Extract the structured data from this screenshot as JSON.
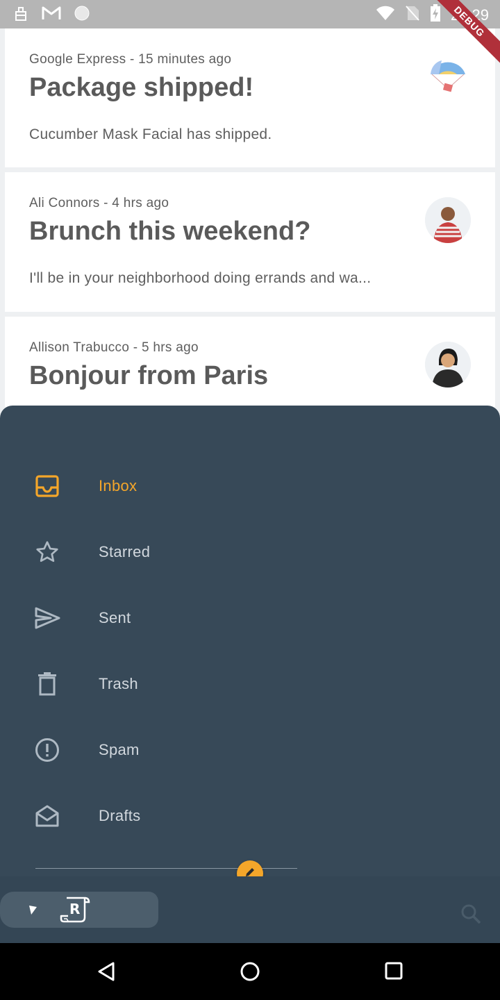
{
  "status_bar": {
    "time": "23:29",
    "debug_label": "DEBUG",
    "icons": [
      "notification-icon",
      "gmail-icon",
      "circle-icon",
      "wifi-icon",
      "no-sim-icon",
      "battery-charging-icon"
    ]
  },
  "emails": [
    {
      "sender": "Google Express",
      "time": "15 minutes ago",
      "meta": "Google Express - 15 minutes ago",
      "subject": "Package shipped!",
      "preview": "Cucumber Mask Facial has shipped.",
      "avatar": "parachute-avatar"
    },
    {
      "sender": "Ali Connors",
      "time": "4 hrs ago",
      "meta": "Ali Connors - 4 hrs ago",
      "subject": "Brunch this weekend?",
      "preview": "I'll be in your neighborhood doing errands and wa...",
      "avatar": "ali-connors-avatar"
    },
    {
      "sender": "Allison Trabucco",
      "time": "5 hrs ago",
      "meta": "Allison Trabucco - 5 hrs ago",
      "subject": "Bonjour from Paris",
      "preview": "",
      "avatar": "allison-trabucco-avatar"
    }
  ],
  "drawer": {
    "items": [
      {
        "label": "Inbox",
        "icon": "inbox-icon",
        "active": true
      },
      {
        "label": "Starred",
        "icon": "star-icon",
        "active": false
      },
      {
        "label": "Sent",
        "icon": "send-icon",
        "active": false
      },
      {
        "label": "Trash",
        "icon": "trash-icon",
        "active": false
      },
      {
        "label": "Spam",
        "icon": "spam-icon",
        "active": false
      },
      {
        "label": "Drafts",
        "icon": "drafts-icon",
        "active": false
      }
    ]
  },
  "bottom_bar": {
    "compose_icon": "pencil-icon",
    "brand_icon": "reply-logo-icon",
    "expand_icon": "triangle-icon",
    "search_icon": "search-icon"
  },
  "colors": {
    "drawer_bg": "#374958",
    "accent": "#f4a62a",
    "nav_text": "#d2d8de",
    "card_bg": "#ffffff"
  }
}
